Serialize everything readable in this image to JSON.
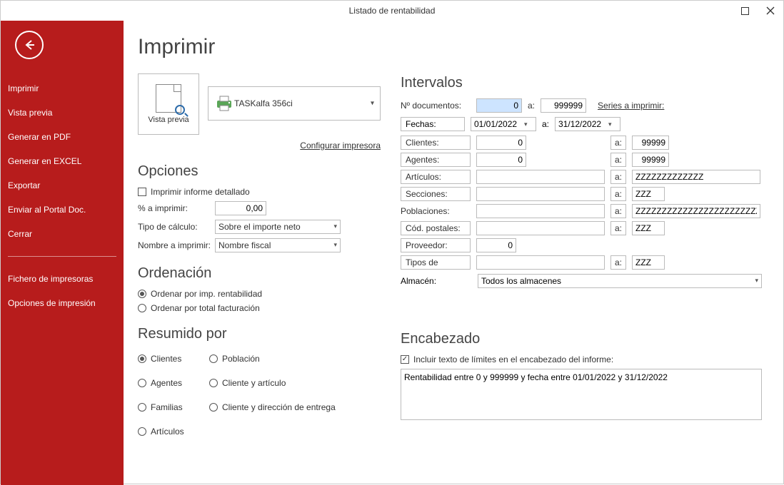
{
  "titlebar": {
    "title": "Listado de rentabilidad"
  },
  "sidebar": {
    "items1": [
      "Imprimir",
      "Vista previa",
      "Generar en PDF",
      "Generar en EXCEL",
      "Exportar",
      "Enviar al Portal Doc.",
      "Cerrar"
    ],
    "items2": [
      "Fichero de impresoras",
      "Opciones de impresión"
    ]
  },
  "page": {
    "title": "Imprimir",
    "preview_label": "Vista previa",
    "printer_name": "TASKalfa 356ci",
    "config_link": "Configurar impresora",
    "options_title": "Opciones",
    "detailed_label": "Imprimir informe detallado",
    "detailed_checked": false,
    "pct_label": "% a imprimir:",
    "pct_value": "0,00",
    "calc_label": "Tipo de cálculo:",
    "calc_value": "Sobre el importe neto",
    "name_label": "Nombre a imprimir:",
    "name_value": "Nombre fiscal",
    "order_title": "Ordenación",
    "order_opt1": "Ordenar por imp. rentabilidad",
    "order_opt2": "Ordenar por total facturación",
    "order_selected": 0,
    "summary_title": "Resumido por",
    "summary_opts": [
      "Clientes",
      "Agentes",
      "Familias",
      "Artículos",
      "Población",
      "Cliente y artículo",
      "Cliente y dirección de entrega"
    ],
    "summary_selected": 0
  },
  "intervals": {
    "title": "Intervalos",
    "doc_label": "Nº documentos:",
    "doc_from": "0",
    "doc_to": "999999",
    "series_link": "Series a imprimir:",
    "a_label": "a:",
    "dates_label": "Fechas:",
    "date_from": "01/01/2022",
    "date_to": "31/12/2022",
    "clients_label": "Clientes:",
    "clients_from": "0",
    "clients_to": "99999",
    "agents_label": "Agentes:",
    "agents_from": "0",
    "agents_to": "99999",
    "arts_label": "Artículos:",
    "arts_from": "",
    "arts_to": "ZZZZZZZZZZZZZ",
    "secs_label": "Secciones:",
    "secs_from": "",
    "secs_to": "ZZZ",
    "pobl_label": "Poblaciones:",
    "pobl_from": "",
    "pobl_to": "ZZZZZZZZZZZZZZZZZZZZZZZZZ",
    "cp_label": "Cód. postales:",
    "cp_from": "",
    "cp_to": "ZZZ",
    "prov_label": "Proveedor:",
    "prov_val": "0",
    "types_label": "Tipos de",
    "types_from": "",
    "types_to": "ZZZ",
    "alm_label": "Almacén:",
    "alm_value": "Todos los almacenes"
  },
  "header": {
    "title": "Encabezado",
    "include_label": "Incluir texto de límites en el encabezado del informe:",
    "include_checked": true,
    "text": "Rentabilidad entre 0 y 999999 y fecha entre 01/01/2022 y 31/12/2022"
  }
}
